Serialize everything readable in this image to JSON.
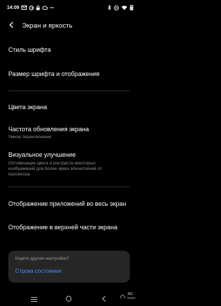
{
  "status_bar": {
    "time": "14:09",
    "left_icons": [
      "mail-icon",
      "google-icon",
      "lock-icon",
      "cloud-icon",
      "more-dots-icon"
    ],
    "right_icons": [
      "bluetooth-icon",
      "do-not-disturb-icon",
      "wifi-icon",
      "battery-icon"
    ]
  },
  "header": {
    "title": "Экран и яркость"
  },
  "settings": {
    "font_style": {
      "title": "Стиль шрифта"
    },
    "font_size": {
      "title": "Размер шрифта и отображения"
    },
    "screen_colors": {
      "title": "Цвета экрана"
    },
    "refresh_rate": {
      "title": "Частота обновления экрана",
      "subtitle": "Умное переключение"
    },
    "visual_enhancement": {
      "title": "Визуальное улучшение",
      "subtitle_line1": "Оптимизация цвета и контраста некоторых",
      "subtitle_line2": "изображений для более ярких впечатлений от",
      "subtitle_line3": "просмотра"
    },
    "fullscreen_apps": {
      "title": "Отображение приложений во весь экран"
    },
    "top_display": {
      "title": "Отображение в верхней части экрана"
    }
  },
  "suggestion": {
    "question": "Ищете другие настройки?",
    "link": "Строка состояния"
  },
  "nav_bar": {
    "buttons": [
      "menu-icon",
      "home-icon",
      "back-icon"
    ]
  },
  "watermark": {
    "line1": "3D",
    "line2": "news"
  },
  "colors": {
    "background": "#000000",
    "text": "#ffffff",
    "subtext": "#8e8e8e",
    "accent": "#4a8cff",
    "card": "#262626"
  }
}
